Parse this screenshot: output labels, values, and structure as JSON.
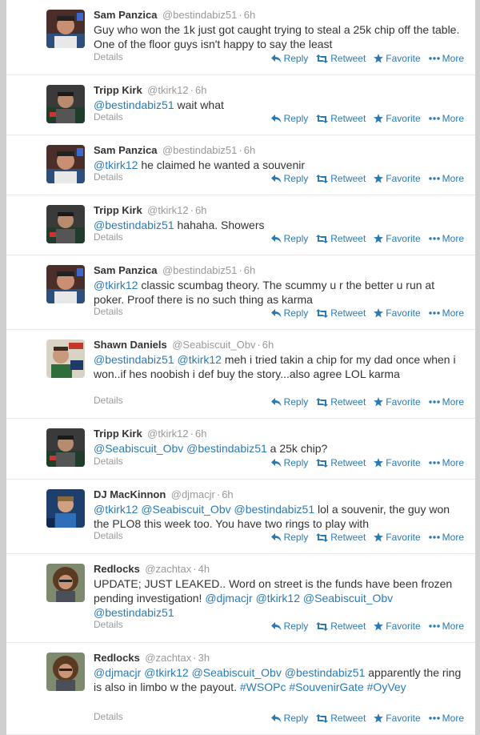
{
  "action_labels": {
    "reply": "Reply",
    "retweet": "Retweet",
    "favorite": "Favorite",
    "more": "More",
    "details": "Details"
  },
  "icons": {
    "reply": "reply-icon",
    "retweet": "retweet-icon",
    "favorite": "star-icon",
    "more": "more-dots-icon"
  },
  "colors": {
    "link": "#2a7ab5",
    "text": "#333333",
    "muted": "#999999",
    "divider": "#e8e8e8",
    "page_bg": "#cfcfcf"
  },
  "tweets": [
    {
      "fullname": "Sam Panzica",
      "username": "@bestindabiz51",
      "time": "6h",
      "avatar": "sam",
      "segments": [
        {
          "t": "text",
          "v": "Guy who won the 1k just got caught trying to steal a 25k chip off the table. One of the floor guys isn't happy to say the least"
        }
      ]
    },
    {
      "fullname": "Tripp Kirk",
      "username": "@tkirk12",
      "time": "6h",
      "avatar": "tripp",
      "segments": [
        {
          "t": "mention",
          "v": "@bestindabiz51"
        },
        {
          "t": "text",
          "v": " wait what"
        }
      ]
    },
    {
      "fullname": "Sam Panzica",
      "username": "@bestindabiz51",
      "time": "6h",
      "avatar": "sam",
      "segments": [
        {
          "t": "mention",
          "v": "@tkirk12"
        },
        {
          "t": "text",
          "v": " he claimed he wanted a souvenir"
        }
      ]
    },
    {
      "fullname": "Tripp Kirk",
      "username": "@tkirk12",
      "time": "6h",
      "avatar": "tripp",
      "segments": [
        {
          "t": "mention",
          "v": "@bestindabiz51"
        },
        {
          "t": "text",
          "v": " hahaha. Showers"
        }
      ]
    },
    {
      "fullname": "Sam Panzica",
      "username": "@bestindabiz51",
      "time": "6h",
      "avatar": "sam",
      "segments": [
        {
          "t": "mention",
          "v": "@tkirk12"
        },
        {
          "t": "text",
          "v": " classic scumbag theory. The scummy u r the better u run at poker. Proof there is no such thing as karma"
        }
      ]
    },
    {
      "fullname": "Shawn Daniels",
      "username": "@Seabiscuit_Obv",
      "time": "6h",
      "avatar": "shawn",
      "segments": [
        {
          "t": "mention",
          "v": "@bestindabiz51"
        },
        {
          "t": "text",
          "v": " "
        },
        {
          "t": "mention",
          "v": "@tkirk12"
        },
        {
          "t": "text",
          "v": " meh i tried takin a chip for my dad once when i won..if hes noobish i def buy the story...also agree LOL karma"
        }
      ]
    },
    {
      "fullname": "Tripp Kirk",
      "username": "@tkirk12",
      "time": "6h",
      "avatar": "tripp",
      "segments": [
        {
          "t": "mention",
          "v": "@Seabiscuit_Obv"
        },
        {
          "t": "text",
          "v": " "
        },
        {
          "t": "mention",
          "v": "@bestindabiz51"
        },
        {
          "t": "text",
          "v": " a 25k chip?"
        }
      ]
    },
    {
      "fullname": "DJ MacKinnon",
      "username": "@djmacjr",
      "time": "6h",
      "avatar": "dj",
      "segments": [
        {
          "t": "mention",
          "v": "@tkirk12"
        },
        {
          "t": "text",
          "v": " "
        },
        {
          "t": "mention",
          "v": "@Seabiscuit_Obv"
        },
        {
          "t": "text",
          "v": " "
        },
        {
          "t": "mention",
          "v": "@bestindabiz51"
        },
        {
          "t": "text",
          "v": " lol a souvenir, the guy won the PLO8 this week too. You have two rings to play with"
        }
      ]
    },
    {
      "fullname": "Redlocks",
      "username": "@zachtax",
      "time": "4h",
      "avatar": "red",
      "segments": [
        {
          "t": "text",
          "v": "UPDATE; JUST LEAKED.. Word on street is the funds have been frozen pending investigation!  "
        },
        {
          "t": "mention",
          "v": "@djmacjr"
        },
        {
          "t": "text",
          "v": " "
        },
        {
          "t": "mention",
          "v": "@tkirk12"
        },
        {
          "t": "text",
          "v": " "
        },
        {
          "t": "mention",
          "v": "@Seabiscuit_Obv"
        },
        {
          "t": "text",
          "v": " "
        },
        {
          "t": "mention",
          "v": "@bestindabiz51"
        }
      ]
    },
    {
      "fullname": "Redlocks",
      "username": "@zachtax",
      "time": "3h",
      "avatar": "red",
      "segments": [
        {
          "t": "mention",
          "v": "@djmacjr"
        },
        {
          "t": "text",
          "v": " "
        },
        {
          "t": "mention",
          "v": "@tkirk12"
        },
        {
          "t": "text",
          "v": " "
        },
        {
          "t": "mention",
          "v": "@Seabiscuit_Obv"
        },
        {
          "t": "text",
          "v": " "
        },
        {
          "t": "mention",
          "v": "@bestindabiz51"
        },
        {
          "t": "text",
          "v": " apparently the ring is also in limbo w the payout. "
        },
        {
          "t": "hashtag",
          "v": "#WSOPc"
        },
        {
          "t": "text",
          "v": " "
        },
        {
          "t": "hashtag",
          "v": "#SouvenirGate"
        },
        {
          "t": "text",
          "v": " "
        },
        {
          "t": "hashtag",
          "v": "#OyVey"
        }
      ]
    }
  ]
}
